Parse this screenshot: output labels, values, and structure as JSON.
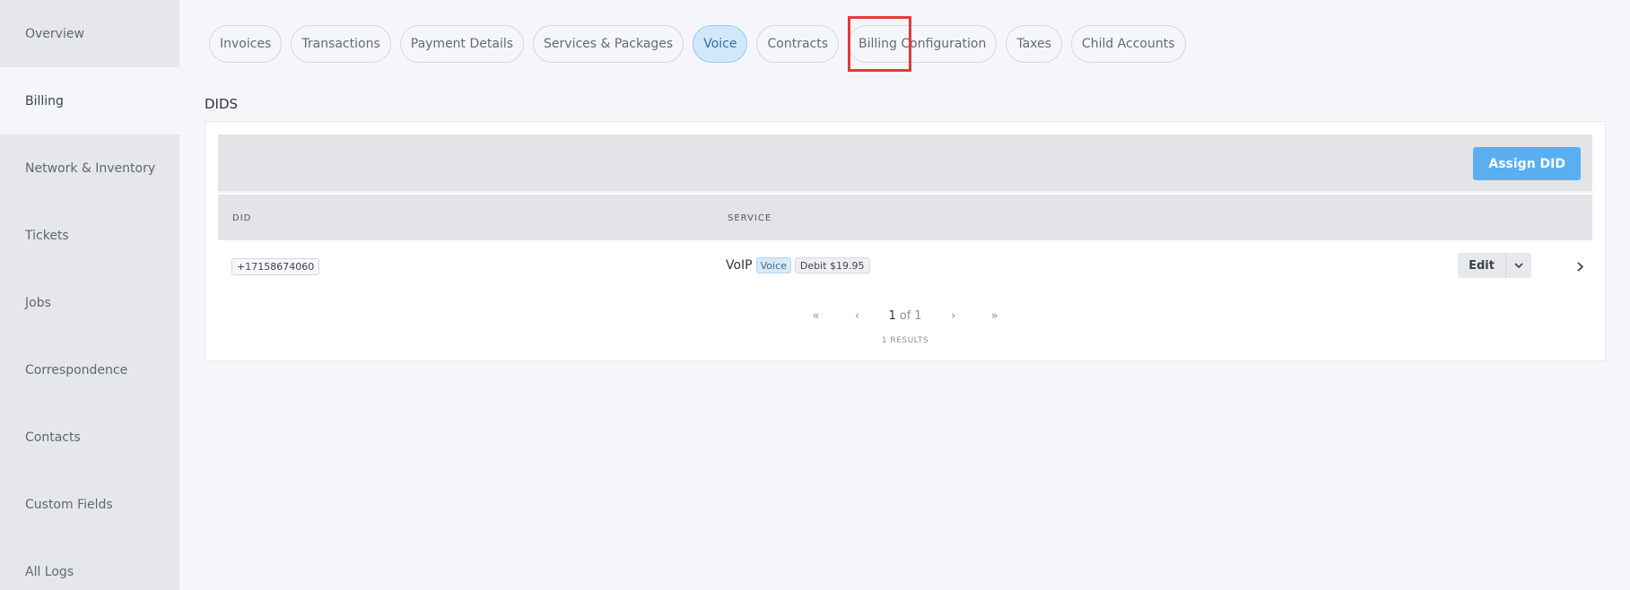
{
  "sidebar": {
    "items": [
      {
        "label": "Overview"
      },
      {
        "label": "Billing"
      },
      {
        "label": "Network & Inventory"
      },
      {
        "label": "Tickets"
      },
      {
        "label": "Jobs"
      },
      {
        "label": "Correspondence"
      },
      {
        "label": "Contacts"
      },
      {
        "label": "Custom Fields"
      },
      {
        "label": "All Logs"
      }
    ],
    "active": "Billing"
  },
  "tabs": {
    "items": [
      {
        "label": "Invoices"
      },
      {
        "label": "Transactions"
      },
      {
        "label": "Payment Details"
      },
      {
        "label": "Services & Packages"
      },
      {
        "label": "Voice"
      },
      {
        "label": "Contracts"
      },
      {
        "label": "Billing Configuration"
      },
      {
        "label": "Taxes"
      },
      {
        "label": "Child Accounts"
      }
    ],
    "active": "Voice"
  },
  "section": {
    "title": "DIDS"
  },
  "toolbar": {
    "assign_label": "Assign DID"
  },
  "table": {
    "columns": {
      "did": "DID",
      "service": "SERVICE"
    },
    "rows": [
      {
        "did": "+17158674060",
        "service_name": "VoIP",
        "service_badge": "Voice",
        "price_badge": "Debit $19.95",
        "edit_label": "Edit"
      }
    ]
  },
  "pagination": {
    "current": "1",
    "of_label": "of",
    "total": "1",
    "first": "«",
    "prev": "‹",
    "next": "›",
    "last": "»",
    "results": "1 RESULTS"
  },
  "colors": {
    "accent": "#5aaef2",
    "active_tab_bg": "#cfe8fa",
    "highlight": "#e53935"
  }
}
